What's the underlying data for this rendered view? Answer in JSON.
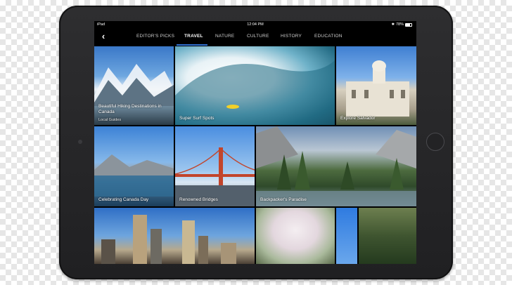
{
  "status_bar": {
    "device": "iPad",
    "time": "12:04 PM",
    "battery": "78%"
  },
  "nav": {
    "back_icon": "chevron-left-icon",
    "tabs": [
      {
        "label": "EDITOR'S PICKS",
        "active": false
      },
      {
        "label": "TRAVEL",
        "active": true
      },
      {
        "label": "NATURE",
        "active": false
      },
      {
        "label": "CULTURE",
        "active": false
      },
      {
        "label": "HISTORY",
        "active": false
      },
      {
        "label": "EDUCATION",
        "active": false
      }
    ],
    "accent_color": "#2f6fd1"
  },
  "tiles": {
    "hiking": {
      "title": "Beautiful Hiking Destinations in Canada",
      "subtitle": "Local Guides"
    },
    "surf": {
      "title": "Super Surf Spots"
    },
    "salvador": {
      "title": "Explore Salvador"
    },
    "canada_day": {
      "title": "Celebrating Canada Day"
    },
    "bridges": {
      "title": "Renowned Bridges"
    },
    "backpacker": {
      "title": "Backpacker's Paradise"
    },
    "city": {
      "title": ""
    },
    "blossom": {
      "title": ""
    },
    "sky": {
      "title": ""
    },
    "garden": {
      "title": ""
    }
  }
}
